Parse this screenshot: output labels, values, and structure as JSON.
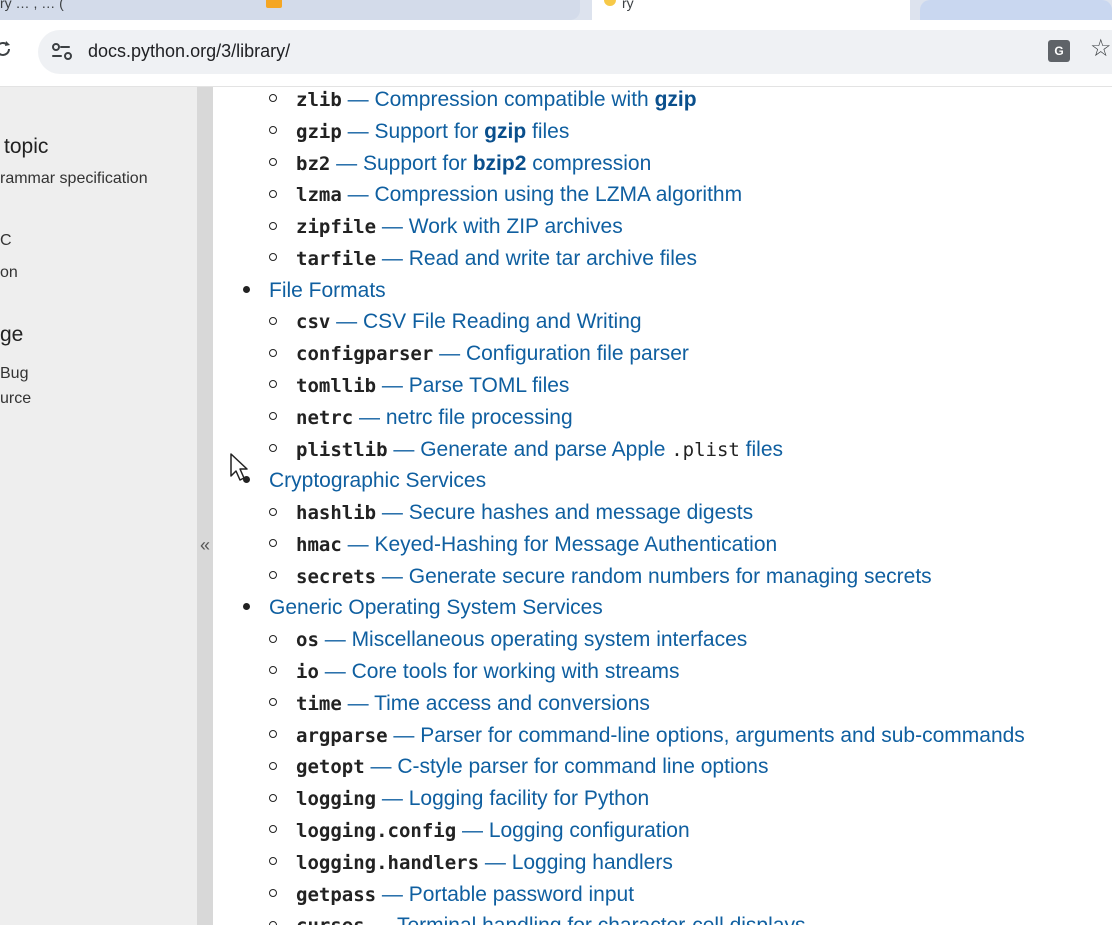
{
  "tabs": [
    {
      "title": "ry …                                   , …              (   "
    },
    {
      "title": "                ry"
    },
    {
      "title": ""
    }
  ],
  "omnibox": {
    "url": "docs.python.org/3/library/"
  },
  "sidebar": {
    "heading1": "topic",
    "item1": "rammar specification",
    "item2": "C",
    "item3": "on",
    "heading2": "ge",
    "item4": "Bug",
    "item5": "urce",
    "collapse_label": "«"
  },
  "content": {
    "rows": [
      {
        "level": 2,
        "mod": "zlib",
        "sep": " — ",
        "parts": [
          "Compression compatible with ",
          {
            "b": "gzip"
          }
        ]
      },
      {
        "level": 2,
        "mod": "gzip",
        "sep": " — ",
        "parts": [
          "Support for ",
          {
            "b": "gzip"
          },
          " files"
        ]
      },
      {
        "level": 2,
        "mod": "bz2",
        "sep": " — ",
        "parts": [
          "Support for ",
          {
            "b": "bzip2"
          },
          " compression"
        ]
      },
      {
        "level": 2,
        "mod": "lzma",
        "sep": " — ",
        "parts": [
          "Compression using the LZMA algorithm"
        ]
      },
      {
        "level": 2,
        "mod": "zipfile",
        "sep": " — ",
        "parts": [
          "Work with ZIP archives"
        ]
      },
      {
        "level": 2,
        "mod": "tarfile",
        "sep": " — ",
        "parts": [
          "Read and write tar archive files"
        ]
      },
      {
        "level": 1,
        "text": "File Formats"
      },
      {
        "level": 2,
        "mod": "csv",
        "sep": " — ",
        "parts": [
          "CSV File Reading and Writing"
        ]
      },
      {
        "level": 2,
        "mod": "configparser",
        "sep": " — ",
        "parts": [
          "Configuration file parser"
        ]
      },
      {
        "level": 2,
        "mod": "tomllib",
        "sep": " — ",
        "parts": [
          "Parse TOML files"
        ]
      },
      {
        "level": 2,
        "mod": "netrc",
        "sep": " — ",
        "parts": [
          "netrc file processing"
        ]
      },
      {
        "level": 2,
        "mod": "plistlib",
        "sep": " — ",
        "parts": [
          "Generate and parse Apple ",
          {
            "c": ".plist"
          },
          " files"
        ]
      },
      {
        "level": 1,
        "text": "Cryptographic Services"
      },
      {
        "level": 2,
        "mod": "hashlib",
        "sep": " — ",
        "parts": [
          "Secure hashes and message digests"
        ]
      },
      {
        "level": 2,
        "mod": "hmac",
        "sep": " — ",
        "parts": [
          "Keyed-Hashing for Message Authentication"
        ]
      },
      {
        "level": 2,
        "mod": "secrets",
        "sep": " — ",
        "parts": [
          "Generate secure random numbers for managing secrets"
        ]
      },
      {
        "level": 1,
        "text": "Generic Operating System Services"
      },
      {
        "level": 2,
        "mod": "os",
        "sep": " — ",
        "parts": [
          "Miscellaneous operating system interfaces"
        ]
      },
      {
        "level": 2,
        "mod": "io",
        "sep": " — ",
        "parts": [
          "Core tools for working with streams"
        ]
      },
      {
        "level": 2,
        "mod": "time",
        "sep": " — ",
        "parts": [
          "Time access and conversions"
        ]
      },
      {
        "level": 2,
        "mod": "argparse",
        "sep": " — ",
        "parts": [
          "Parser for command-line options, arguments and sub-commands"
        ]
      },
      {
        "level": 2,
        "mod": "getopt",
        "sep": " — ",
        "parts": [
          "C-style parser for command line options"
        ]
      },
      {
        "level": 2,
        "mod": "logging",
        "sep": " — ",
        "parts": [
          "Logging facility for Python"
        ]
      },
      {
        "level": 2,
        "mod": "logging.config",
        "sep": " — ",
        "parts": [
          "Logging configuration"
        ]
      },
      {
        "level": 2,
        "mod": "logging.handlers",
        "sep": " — ",
        "parts": [
          "Logging handlers"
        ]
      },
      {
        "level": 2,
        "mod": "getpass",
        "sep": " — ",
        "parts": [
          "Portable password input"
        ]
      },
      {
        "level": 2,
        "mod": "curses",
        "sep": " — ",
        "parts": [
          "Terminal handling for character-cell displays"
        ]
      }
    ]
  },
  "icons": {
    "reload": "reload-icon",
    "site_info": "site-info-icon",
    "translate": "translate-icon",
    "bookmark": "star-icon",
    "cursor": "mouse-pointer-icon"
  },
  "colors": {
    "link": "#0f5fa0",
    "sidebar_bg": "#eeeeee",
    "omnibox_bg": "#eff1f4"
  }
}
